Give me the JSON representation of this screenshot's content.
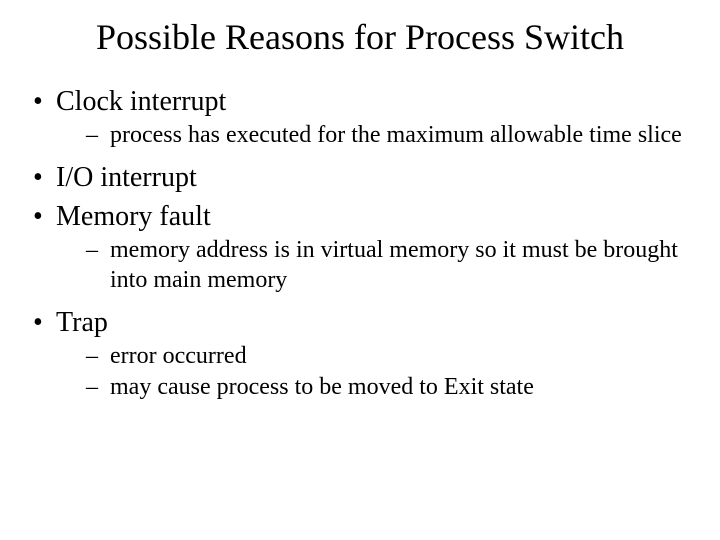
{
  "title": "Possible Reasons for Process Switch",
  "items": [
    {
      "label": "Clock interrupt",
      "subitems": [
        "process has executed for the maximum allowable time slice"
      ]
    },
    {
      "label": "I/O interrupt",
      "subitems": []
    },
    {
      "label": "Memory fault",
      "subitems": [
        "memory address is in virtual memory so it must be brought into main memory"
      ]
    },
    {
      "label": "Trap",
      "subitems": [
        "error occurred",
        "may cause process to be moved to Exit state"
      ]
    }
  ]
}
